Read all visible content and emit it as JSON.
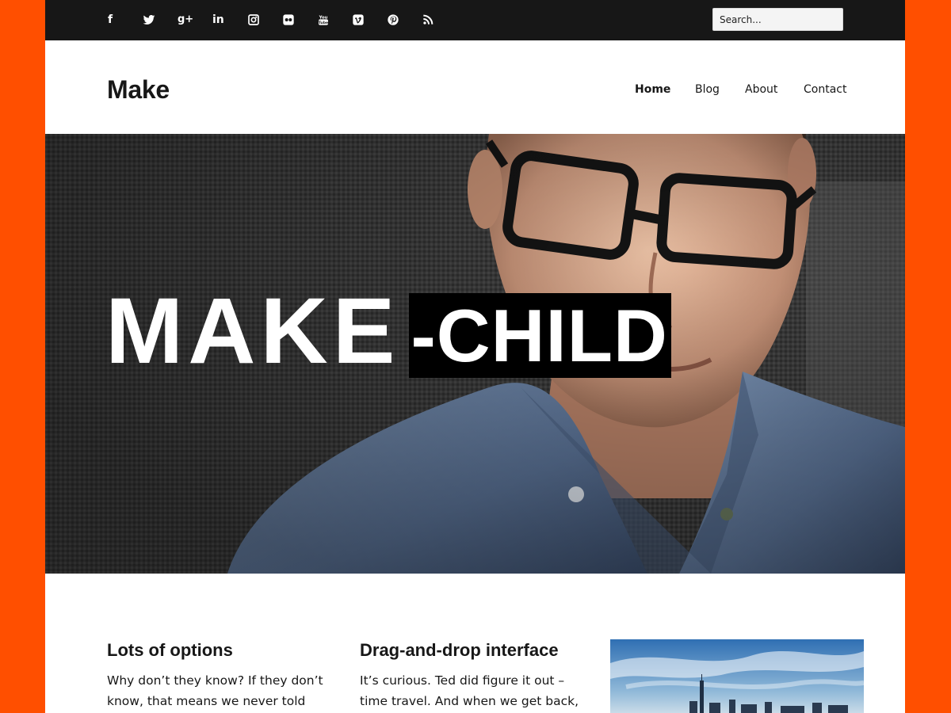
{
  "social": {
    "items": [
      {
        "name": "facebook",
        "label": "f"
      },
      {
        "name": "twitter",
        "label": ""
      },
      {
        "name": "google-plus",
        "label": "g+"
      },
      {
        "name": "linkedin",
        "label": "in"
      },
      {
        "name": "instagram",
        "label": ""
      },
      {
        "name": "flickr",
        "label": ""
      },
      {
        "name": "youtube",
        "label": "You"
      },
      {
        "name": "vimeo",
        "label": "v"
      },
      {
        "name": "pinterest",
        "label": ""
      },
      {
        "name": "rss",
        "label": ""
      }
    ]
  },
  "search": {
    "placeholder": "Search..."
  },
  "header": {
    "site_title": "Make"
  },
  "nav": {
    "items": [
      {
        "label": "Home",
        "active": true
      },
      {
        "label": "Blog"
      },
      {
        "label": "About"
      },
      {
        "label": "Contact"
      }
    ]
  },
  "hero": {
    "title_part1": "MAKE",
    "title_part2": "-CHILD"
  },
  "columns": [
    {
      "heading": "Lots of options",
      "text": "Why don’t they know? If they don’t know, that means we never told"
    },
    {
      "heading": "Drag-and-drop interface",
      "text": "It’s curious. Ted did figure it out – time travel. And when we get back,"
    }
  ],
  "colors": {
    "frame": "#ff4f00",
    "topbar": "#171717",
    "text": "#171717"
  }
}
